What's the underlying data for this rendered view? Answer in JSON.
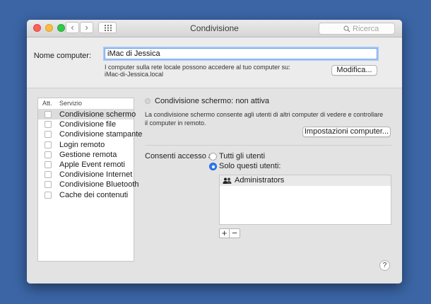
{
  "window": {
    "title": "Condivisione",
    "search_placeholder": "Ricerca",
    "back_glyph": "‹",
    "forward_glyph": "›"
  },
  "computer_name": {
    "label": "Nome computer:",
    "value": "iMac di Jessica",
    "note_line1": "I computer sulla rete locale possono accedere al tuo computer su:",
    "note_line2": "iMac-di-Jessica.local",
    "modify_button": "Modifica..."
  },
  "services": {
    "header_on": "Att.",
    "header_service": "Servizio",
    "items": [
      {
        "label": "Condivisione schermo",
        "checked": false,
        "selected": true
      },
      {
        "label": "Condivisione file",
        "checked": false,
        "selected": false
      },
      {
        "label": "Condivisione stampante",
        "checked": false,
        "selected": false
      },
      {
        "label": "Login remoto",
        "checked": false,
        "selected": false
      },
      {
        "label": "Gestione remota",
        "checked": false,
        "selected": false
      },
      {
        "label": "Apple Event remoti",
        "checked": false,
        "selected": false
      },
      {
        "label": "Condivisione Internet",
        "checked": false,
        "selected": false
      },
      {
        "label": "Condivisione Bluetooth",
        "checked": false,
        "selected": false
      },
      {
        "label": "Cache dei contenuti",
        "checked": false,
        "selected": false
      }
    ]
  },
  "detail": {
    "status": "Condivisione schermo: non attiva",
    "description": "La condivisione schermo consente agli utenti di altri computer di vedere e controllare il computer in remoto.",
    "settings_button": "Impostazioni computer...",
    "access_label": "Consenti accesso a:",
    "option_all": "Tutti gli utenti",
    "option_only": "Solo questi utenti:",
    "selected_option": "only",
    "users": [
      "Administrators"
    ],
    "add_button": "+",
    "remove_button": "−",
    "help_button": "?"
  },
  "colors": {
    "desktop": "#3b65a5",
    "accent": "#2e7cf6"
  }
}
